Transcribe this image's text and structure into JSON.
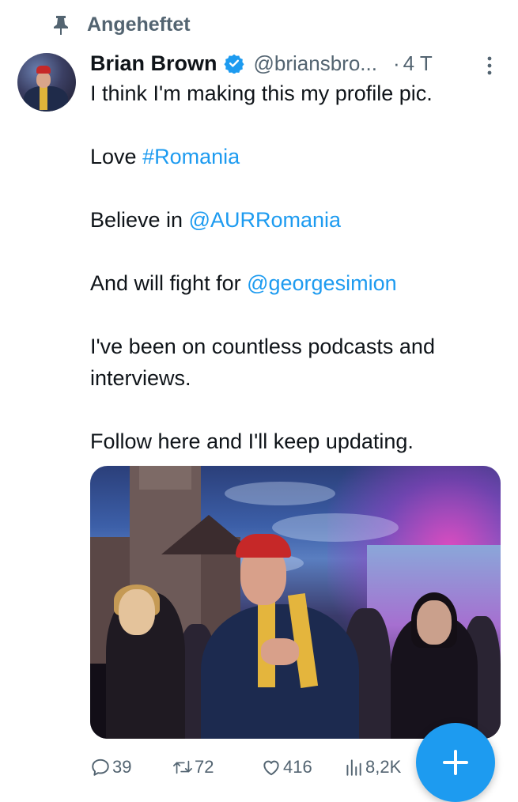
{
  "pinned": {
    "label": "Angeheftet"
  },
  "author": {
    "name": "Brian Brown",
    "handle": "@briansbro...",
    "separator": "·",
    "time": "4 T"
  },
  "tweet": {
    "line1": "I think I'm making this my profile pic.",
    "love_text": "Love ",
    "love_hashtag": "#Romania",
    "believe_text": "Believe in ",
    "believe_mention": "@AURRomania",
    "fight_text": "And will fight for ",
    "fight_mention": "@georgesimion",
    "podcasts": "I've been on countless podcasts and interviews.",
    "follow": "Follow here and I'll keep updating."
  },
  "actions": {
    "replies": "39",
    "retweets": "72",
    "likes": "416",
    "views": "8,2K"
  },
  "colors": {
    "link": "#1d9bf0",
    "muted": "#536471",
    "text": "#0f1419",
    "fab": "#1d9bf0"
  },
  "icons": {
    "pinned": "pin-icon",
    "verified": "verified-badge-icon",
    "more": "more-vertical-icon",
    "reply": "reply-icon",
    "retweet": "retweet-icon",
    "like": "heart-icon",
    "views": "views-icon",
    "compose": "plus-icon"
  }
}
